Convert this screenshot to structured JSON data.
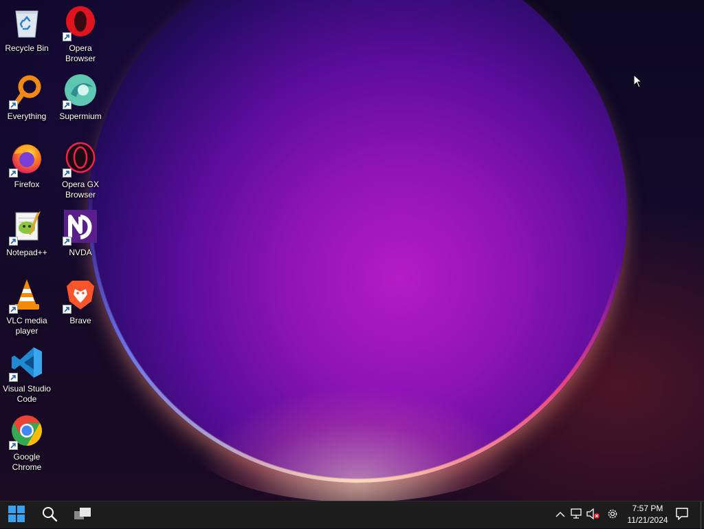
{
  "desktop": {
    "icons": [
      {
        "label": "Recycle Bin",
        "icon": "recycle-bin-icon"
      },
      {
        "label": "Opera Browser",
        "icon": "opera-icon"
      },
      {
        "label": "Everything",
        "icon": "everything-search-icon"
      },
      {
        "label": "Supermium",
        "icon": "supermium-icon"
      },
      {
        "label": "Firefox",
        "icon": "firefox-icon"
      },
      {
        "label": "Opera GX Browser",
        "icon": "opera-gx-icon"
      },
      {
        "label": "Notepad++",
        "icon": "notepadpp-icon"
      },
      {
        "label": "NVDA",
        "icon": "nvda-icon"
      },
      {
        "label": "VLC media player",
        "icon": "vlc-icon"
      },
      {
        "label": "Brave",
        "icon": "brave-icon"
      },
      {
        "label": "Visual Studio Code",
        "icon": "vscode-icon"
      },
      {
        "label": "Google Chrome",
        "icon": "chrome-icon"
      }
    ]
  },
  "taskbar": {
    "start_icon": "windows-start-icon",
    "search_icon": "search-icon",
    "taskview_icon": "task-view-icon",
    "tray": {
      "chevron_icon": "chevron-up-icon",
      "network_icon": "network-icon",
      "volume_icon": "volume-muted-icon",
      "settings_icon": "gear-icon",
      "notification_icon": "notification-icon"
    },
    "clock": {
      "time": "7:57 PM",
      "date": "11/21/2024"
    }
  },
  "colors": {
    "taskbar": "#1c1c1c",
    "start_blue": "#3aa0f0",
    "orb_magenta": "#b41cc6"
  }
}
